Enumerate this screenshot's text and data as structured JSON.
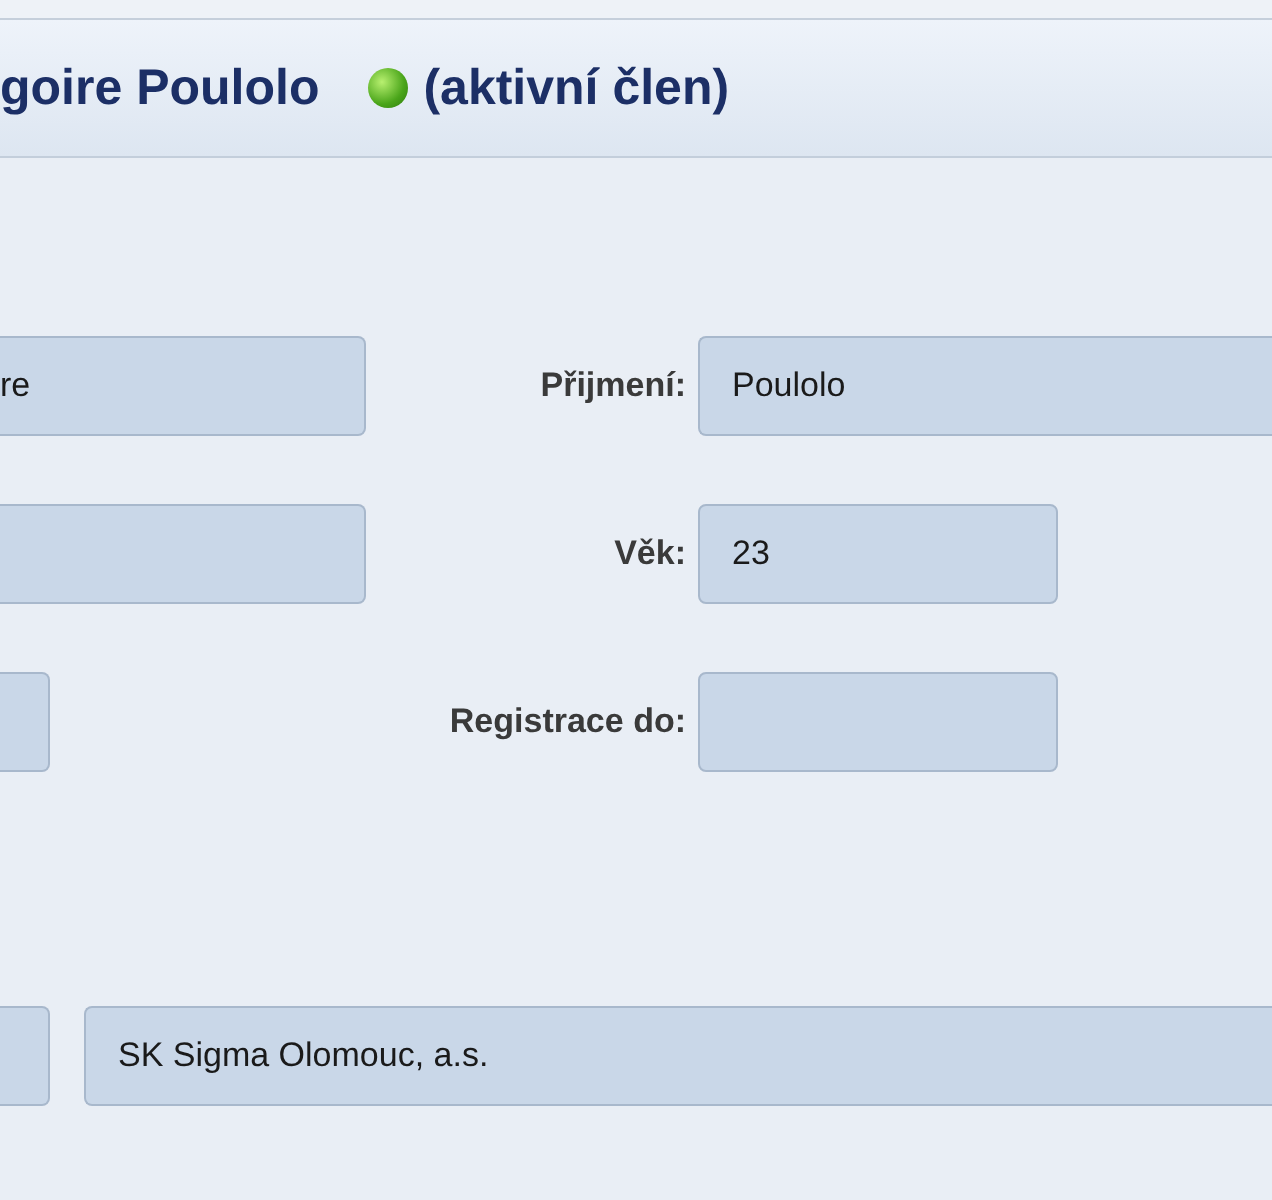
{
  "header": {
    "name": "goire Poulolo",
    "status": {
      "active": true,
      "label": "(aktivní člen)"
    }
  },
  "rows": [
    {
      "kind": "pair",
      "left_value": "re",
      "label": "Přijmení:",
      "value": "Poulolo"
    },
    {
      "kind": "pair",
      "label": "Věk:",
      "value": "23"
    },
    {
      "kind": "pair",
      "label": "Registrace do:"
    },
    {
      "kind": "club",
      "value": "SK Sigma Olomouc, a.s."
    }
  ]
}
